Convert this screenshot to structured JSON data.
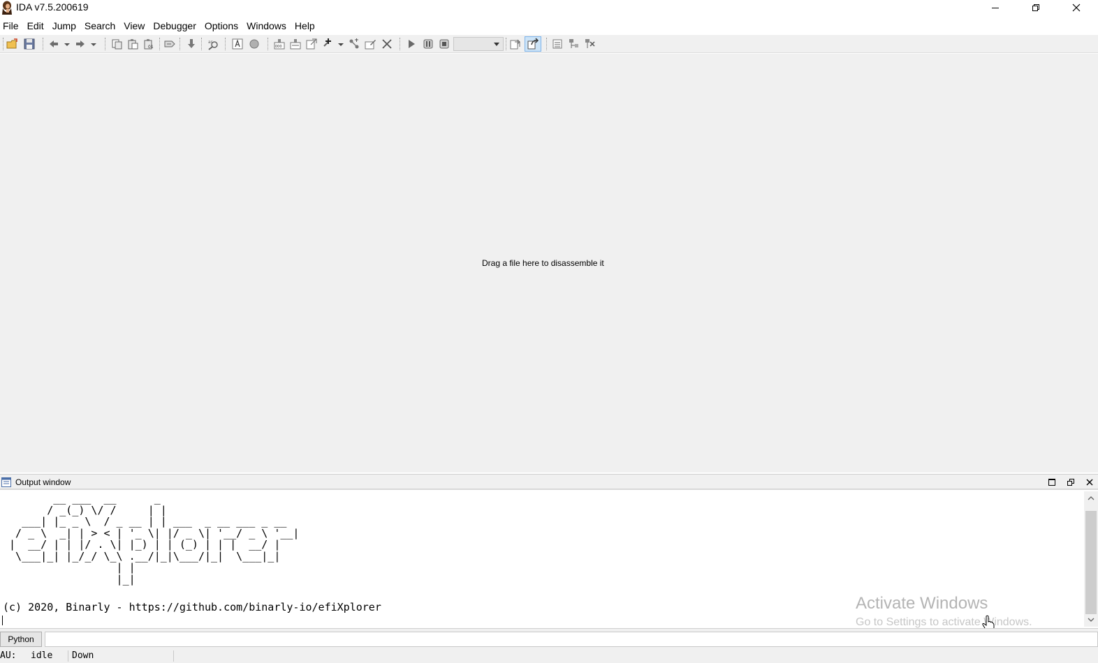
{
  "window": {
    "title": "IDA v7.5.200619",
    "icon": "ida-woman-icon",
    "controls": [
      "minimize-icon",
      "maximize-icon",
      "close-icon"
    ]
  },
  "menu": [
    "File",
    "Edit",
    "Jump",
    "Search",
    "View",
    "Debugger",
    "Options",
    "Windows",
    "Help"
  ],
  "toolbar": {
    "icons": [
      "open-folder-icon",
      "save-icon",
      "back-icon",
      "back-dropdown-icon",
      "forward-icon",
      "forward-dropdown-icon",
      "copy-icon",
      "paste-icon",
      "paste-special-icon",
      "patch-icon",
      "jump-down-icon",
      "search-icon",
      "text-icon",
      "circle-icon",
      "segment-icon",
      "struct-icon",
      "xref-icon",
      "add-icon",
      "add-dropdown-icon",
      "graph-icon",
      "edit-icon",
      "delete-icon",
      "play-icon",
      "pause-icon",
      "stop-icon",
      "debugger-select",
      "attach-icon",
      "switch-icon",
      "list-icon",
      "tree-icon",
      "tree-delete-icon"
    ],
    "debugger_select_value": ""
  },
  "main": {
    "hint": "Drag a file here to disassemble it"
  },
  "output": {
    "title": "Output window",
    "ascii_art": "        __ ___  __      _\n       / _(_) \\/ /     | |\n   ___| |_ _ \\  / _ __ | | ___  _ __ ___ _ __\n  / _ \\  _| | > < | '_ \\| |/ _ \\| '__/ _ \\ '__|\n |  __/ | | |/ . \\| |_) | | (_) | | |  __/ |\n  \\___|_| |_/_/ \\_\\ .__/|_|\\___/|_|  \\___|_|\n                  | |\n                  |_|",
    "copyright": "(c) 2020, Binarly - https://github.com/binarly-io/efiXplorer",
    "header_buttons": [
      "maximize-icon",
      "float-icon",
      "close-icon"
    ]
  },
  "watermark": {
    "title": "Activate Windows",
    "subtitle": "Go to Settings to activate Windows."
  },
  "cmdline": {
    "language": "Python",
    "value": ""
  },
  "status": {
    "au_label": "AU:",
    "au_state": "idle",
    "direction": "Down"
  }
}
